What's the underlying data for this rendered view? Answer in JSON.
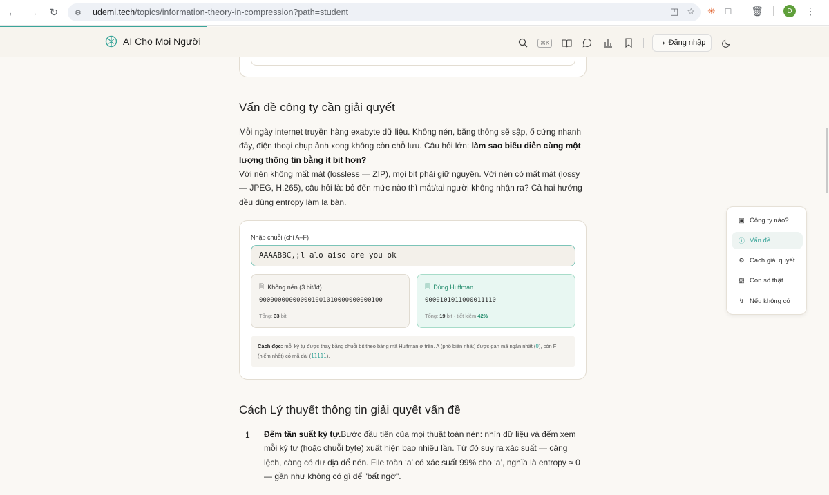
{
  "browser": {
    "url_domain": "udemi.tech",
    "url_path": "/topics/information-theory-in-compression?path=student",
    "avatar_letter": "D"
  },
  "header": {
    "brand": "AI Cho Mọi Người",
    "search_shortcut": "⌘K",
    "login_label": "Đăng nhập"
  },
  "section1": {
    "title": "Vấn đề công ty cần giải quyết",
    "p1_text": "Mỗi ngày internet truyền hàng exabyte dữ liệu. Không nén, băng thông sẽ sập, ổ cứng nhanh đầy, điện thoại chụp ảnh xong không còn chỗ lưu. Câu hỏi lớn: ",
    "p1_bold": "làm sao biểu diễn cùng một lượng thông tin bằng ít bit hơn?",
    "p2_text": "Với nén không mất mát (lossless — ZIP), mọi bit phải giữ nguyên. Với nén có mất mát (lossy — JPEG, H.265), câu hỏi là: bỏ đến mức nào thì mắt/tai người không nhận ra? Cả hai hướng đều dùng entropy làm la bàn."
  },
  "demo": {
    "input_label": "Nhập chuỗi (chỉ A–F)",
    "input_value": "AAAABBC,;l alo aiso are you ok",
    "raw": {
      "title": "Không nén (3 bit/kt)",
      "bits": "000000000000001001010000000000100",
      "total_prefix": "Tổng: ",
      "total_value": "33",
      "total_unit": " bit"
    },
    "huffman": {
      "title": "Dùng Huffman",
      "bits": "0000101011000011110",
      "total_prefix": "Tổng: ",
      "total_value": "19",
      "total_mid": " bit · tiết kiệm ",
      "saving": "42%"
    },
    "howto": {
      "label": "Cách đọc:",
      "text1": " mỗi ký tự được thay bằng chuỗi bit theo bảng mã Huffman ở trên. A (phổ biến nhất) được gán mã ngắn nhất (",
      "code1": "0",
      "text2": "), còn F (hiếm nhất) có mã dài (",
      "code2": "11111",
      "text3": ")."
    }
  },
  "section2": {
    "title": "Cách Lý thuyết thông tin giải quyết vấn đề",
    "item1_num": "1",
    "item1_bold": "Đếm tần suất ký tự.",
    "item1_text": "Bước đầu tiên của mọi thuật toán nén: nhìn dữ liệu và đếm xem mỗi ký tự (hoặc chuỗi byte) xuất hiện bao nhiêu lần. Từ đó suy ra xác suất — càng lệch, càng có dư địa để nén. File toàn ‘a’ có xác suất 99% cho ‘a’, nghĩa là entropy ≈ 0 — gần như không có gì để \"bất ngờ\"."
  },
  "toc": {
    "items": [
      {
        "label": "Công ty nào?",
        "icon": "building-icon"
      },
      {
        "label": "Vấn đề",
        "icon": "question-circle-icon"
      },
      {
        "label": "Cách giải quyết",
        "icon": "gear-icon"
      },
      {
        "label": "Con số thật",
        "icon": "bar-chart-icon"
      },
      {
        "label": "Nếu không có",
        "icon": "branch-icon"
      }
    ],
    "active_index": 1
  },
  "colors": {
    "accent": "#3aa59a",
    "huffman_green": "#1f8a6a",
    "page_bg": "#faf8f4"
  }
}
